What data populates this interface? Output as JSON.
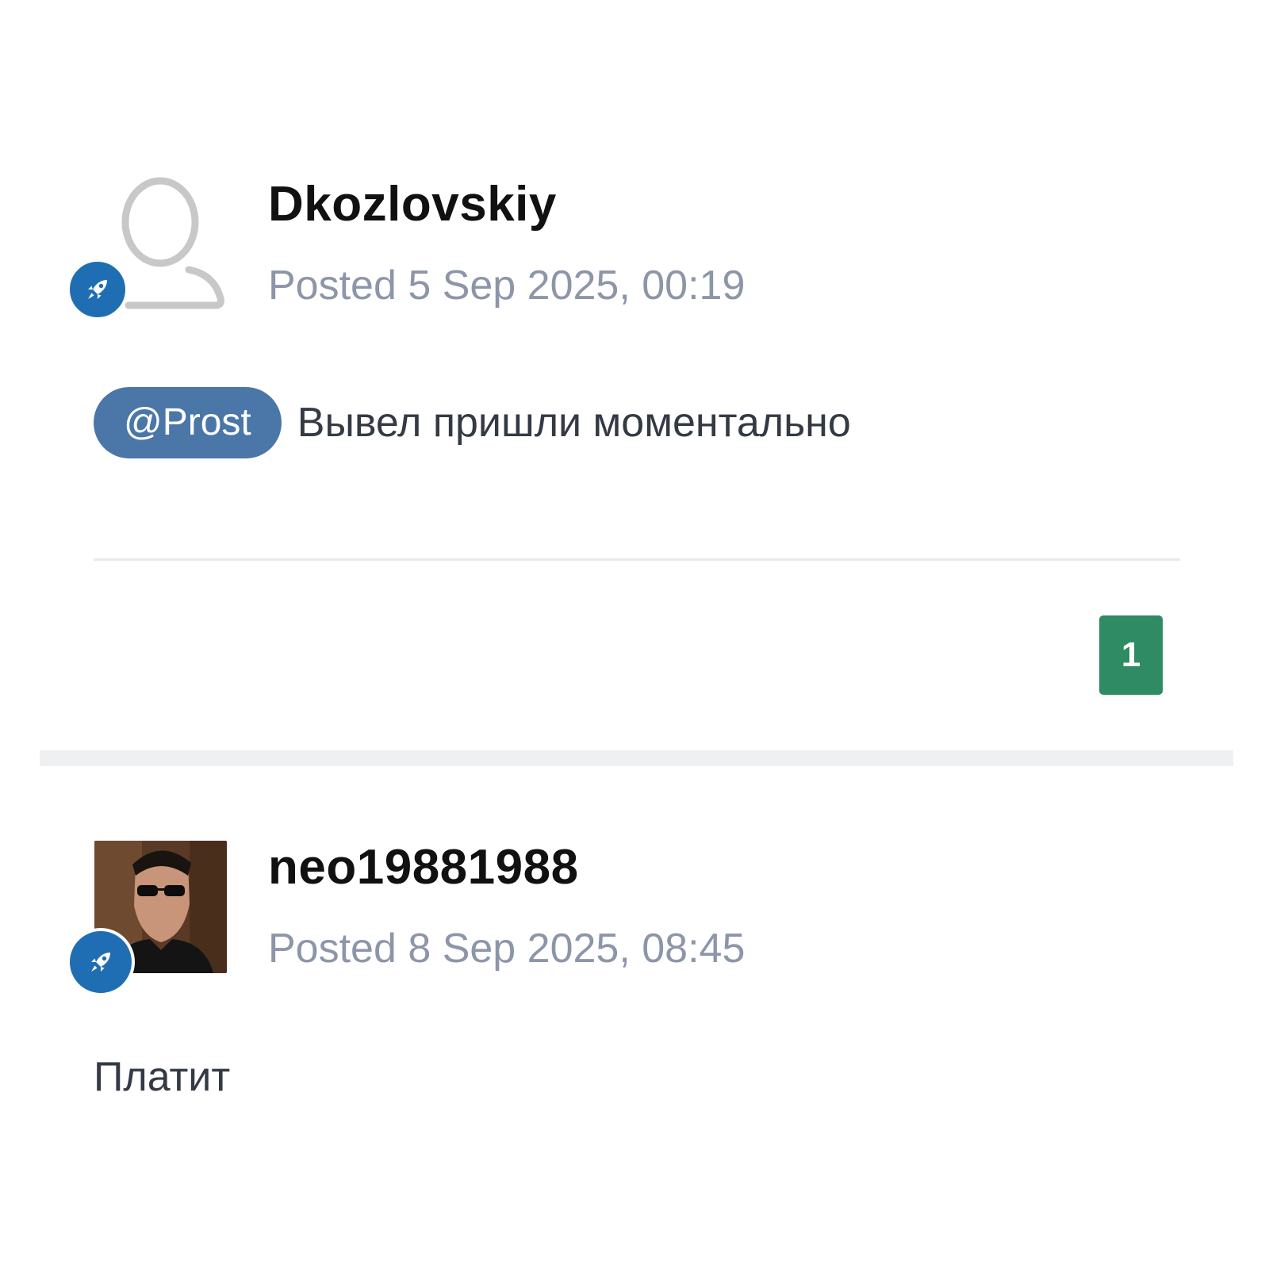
{
  "posts": [
    {
      "author": "Dkozlovskiy",
      "posted": "Posted 5 Sep 2025, 00:19",
      "mention": "@Prost",
      "content": "Вывел пришли моментально",
      "reputation": "1",
      "avatar": "default-avatar-icon",
      "badge_icon": "rocket-icon"
    },
    {
      "author": "neo19881988",
      "posted": "Posted 8 Sep 2025, 08:45",
      "content": "Платит",
      "avatar": "user-photo",
      "badge_icon": "rocket-icon"
    }
  ],
  "colors": {
    "badge": "#1f6eb3",
    "mention": "#4a76a8",
    "reputation": "#2e8b63",
    "meta_text": "#8c96a8"
  }
}
